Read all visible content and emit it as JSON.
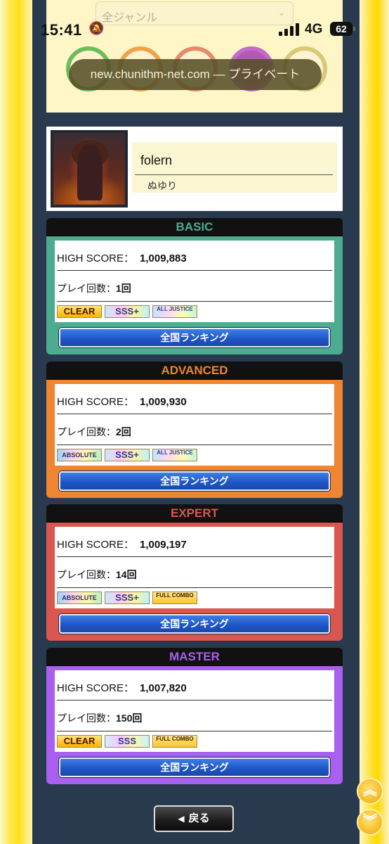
{
  "status_bar": {
    "time": "15:41",
    "network": "4G",
    "battery": "62"
  },
  "browser": {
    "url": "new.chunithm-net.com — プライベート"
  },
  "genre_filter": {
    "selected": "全ジャンル"
  },
  "song": {
    "title": "folern",
    "artist": "ぬゆり"
  },
  "labels": {
    "high_score": "HIGH SCORE：",
    "play_count": "プレイ回数：",
    "ranking_button": "全国ランキング",
    "back_button": "戻る"
  },
  "difficulties": [
    {
      "name": "BASIC",
      "color": "#4dac90",
      "high_score": "1,009,883",
      "play_count": "1回",
      "badges": [
        "CLEAR",
        "SSS+",
        "ALL JUSTICE"
      ]
    },
    {
      "name": "ADVANCED",
      "color": "#ef8530",
      "high_score": "1,009,930",
      "play_count": "2回",
      "badges": [
        "ABSOLUTE",
        "SSS+",
        "ALL JUSTICE"
      ]
    },
    {
      "name": "EXPERT",
      "color": "#d9574e",
      "high_score": "1,009,197",
      "play_count": "14回",
      "badges": [
        "ABSOLUTE",
        "SSS+",
        "FULL COMBO"
      ]
    },
    {
      "name": "MASTER",
      "color": "#a95ff0",
      "high_score": "1,007,820",
      "play_count": "150回",
      "badges": [
        "CLEAR",
        "SSS",
        "FULL COMBO"
      ]
    }
  ],
  "icons": {
    "bell": "bell-slash-icon",
    "back_arrow": "triangle-left-icon",
    "scroll_up": "chevron-double-up-icon",
    "scroll_down": "chevron-double-down-icon"
  }
}
